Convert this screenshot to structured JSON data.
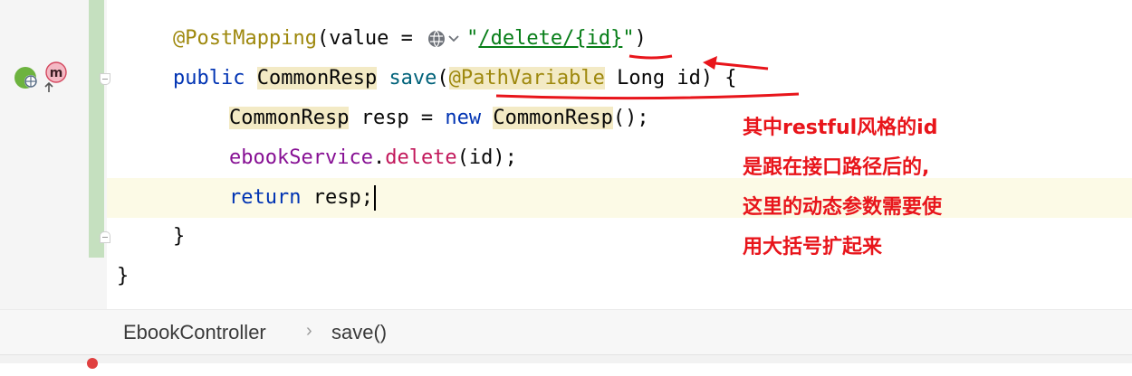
{
  "editor": {
    "lines": [
      {
        "parts": [
          "@PostMapping",
          "(value = ",
          "\"",
          "/delete/{id}",
          "\"",
          ")"
        ]
      },
      {
        "parts": [
          "public",
          " ",
          "CommonResp",
          " ",
          "save",
          "(",
          "@PathVariable",
          " Long id) {"
        ]
      },
      {
        "parts": [
          "CommonResp",
          " resp = ",
          "new",
          " ",
          "CommonResp",
          "();"
        ]
      },
      {
        "parts": [
          "ebookService",
          ".",
          "delete",
          "(id);"
        ]
      },
      {
        "parts": [
          "return",
          " resp;"
        ]
      },
      {
        "parts": [
          "}"
        ]
      },
      {
        "parts": [
          "}"
        ]
      }
    ]
  },
  "annotation_note": {
    "lines": [
      "其中restful风格的id",
      "是跟在接口路径后的,",
      "这里的动态参数需要使",
      "用大括号扩起来"
    ],
    "color": "#e8151b"
  },
  "gutter": {
    "icons": [
      "spring-web-endpoint-icon",
      "method-implementation-icon"
    ],
    "method_badge": "m"
  },
  "breadcrumb": {
    "items": [
      "EbookController",
      "save()"
    ],
    "separator": "›"
  },
  "colors": {
    "annotation": "#9e880d",
    "keyword": "#0033b3",
    "string": "#067d17",
    "method": "#00627a",
    "instance_field": "#871094",
    "call": "#c2185b",
    "highlight": "#f3eac5",
    "vcs_changed": "#c5e0bf",
    "current_line": "#fcfae6"
  }
}
